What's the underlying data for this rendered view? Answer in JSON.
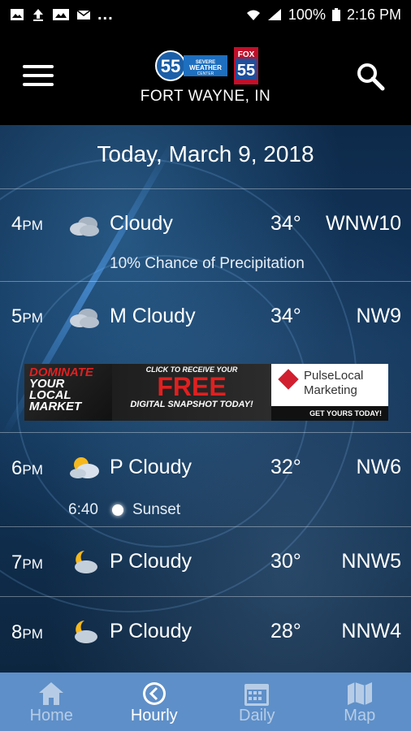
{
  "status_bar": {
    "left_icons": [
      "image-icon",
      "upload-icon",
      "gallery-icon",
      "mail-icon"
    ],
    "more": "...",
    "battery": "100%",
    "time": "2:16 PM"
  },
  "header": {
    "logo_number": "55",
    "logo_text": "SEVERE WEATHER CENTER",
    "fox_badge": "FOX",
    "fox_number": "55",
    "location": "FORT WAYNE, IN"
  },
  "date_title": "Today, March 9, 2018",
  "rows": [
    {
      "hour": "4",
      "ampm": "PM",
      "icon": "cloudy-icon",
      "condition": "Cloudy",
      "temp": "34°",
      "wind": "WNW10",
      "note": "10% Chance of Precipitation"
    },
    {
      "hour": "5",
      "ampm": "PM",
      "icon": "cloudy-icon",
      "condition": "M Cloudy",
      "temp": "34°",
      "wind": "NW9"
    },
    {
      "hour": "6",
      "ampm": "PM",
      "icon": "partly-cloudy-day-icon",
      "condition": "P Cloudy",
      "temp": "32°",
      "wind": "NW6",
      "sunset_time": "6:40",
      "sunset_label": "Sunset"
    },
    {
      "hour": "7",
      "ampm": "PM",
      "icon": "partly-cloudy-night-icon",
      "condition": "P Cloudy",
      "temp": "30°",
      "wind": "NNW5"
    },
    {
      "hour": "8",
      "ampm": "PM",
      "icon": "partly-cloudy-night-icon",
      "condition": "P Cloudy",
      "temp": "28°",
      "wind": "NNW4"
    }
  ],
  "ad": {
    "line1": "DOMINATE",
    "line2": "YOUR",
    "line3": "LOCAL",
    "line4": "MARKET",
    "click": "CLICK TO RECEIVE YOUR",
    "free": "FREE",
    "snapshot": "DIGITAL SNAPSHOT TODAY!",
    "brand1": "PulseLocal",
    "brand2": "Marketing",
    "cta": "GET YOURS TODAY!"
  },
  "nav": [
    {
      "label": "Home",
      "icon": "home-icon",
      "active": false
    },
    {
      "label": "Hourly",
      "icon": "clock-icon",
      "active": true
    },
    {
      "label": "Daily",
      "icon": "calendar-icon",
      "active": false
    },
    {
      "label": "Map",
      "icon": "map-icon",
      "active": false
    }
  ],
  "colors": {
    "nav_bg": "#5e8fc8",
    "accent_red": "#e02020"
  }
}
